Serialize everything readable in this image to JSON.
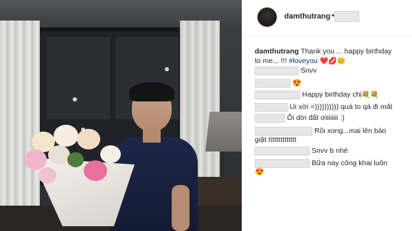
{
  "post": {
    "header": {
      "username": "damthutrang",
      "separator": "•"
    },
    "caption": {
      "username": "damthutrang",
      "text_line1": "Thank you ... happy birthday",
      "text_line2": "to me... !!! ",
      "hashtag": "#loveyou",
      "emojis": "❤️💋😊"
    },
    "comments": [
      {
        "text": "Snvv",
        "emoji": ""
      },
      {
        "text": "",
        "emoji": "😍"
      },
      {
        "text": "Happy birthday chị ",
        "emoji": "💐💐"
      },
      {
        "text": "Ui xời =)))))))))) quà to qá đi mất",
        "emoji": ""
      },
      {
        "text": "Ối dời đất ơiiiiiiii :)",
        "emoji": ""
      },
      {
        "text": "Rồi xong...mai lên báo",
        "text2": "giật títttttttttttt",
        "emoji": ""
      },
      {
        "text": "Snvv b nhé",
        "emoji": ""
      },
      {
        "text": "Bữa nay công khai luôn",
        "emoji": "😍"
      }
    ]
  },
  "colors": {
    "hashtag": "#003569",
    "text": "#262626",
    "border": "#efefef"
  }
}
